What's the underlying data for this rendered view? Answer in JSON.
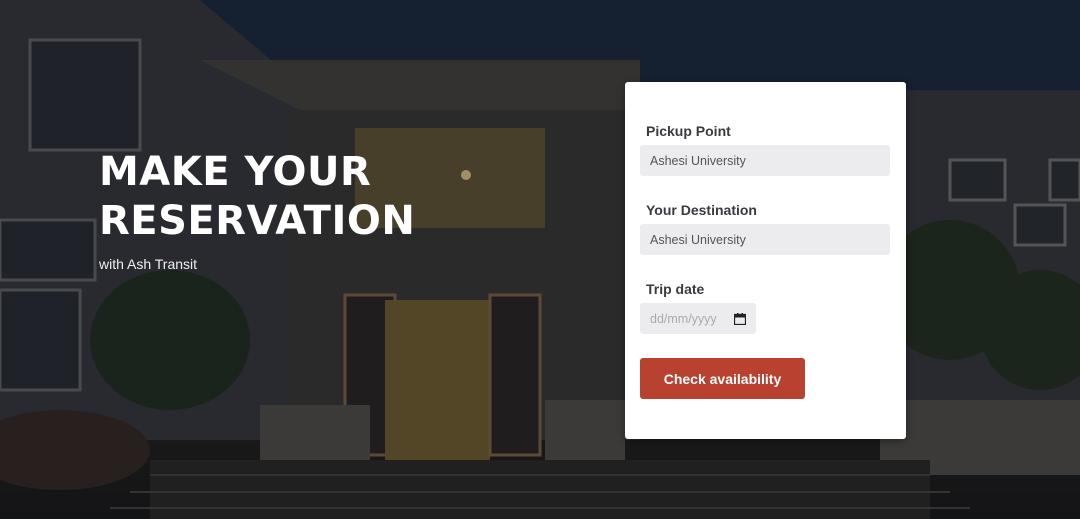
{
  "hero": {
    "title": "MAKE YOUR RESERVATION",
    "subtitle": "with Ash Transit"
  },
  "form": {
    "pickup": {
      "label": "Pickup Point",
      "value": "Ashesi University"
    },
    "destination": {
      "label": "Your Destination",
      "value": "Ashesi University"
    },
    "trip_date": {
      "label": "Trip date",
      "placeholder": "dd/mm/yyyy",
      "icon": "calendar-icon"
    },
    "submit_label": "Check availability"
  },
  "colors": {
    "accent": "#b84130",
    "card": "#ffffff",
    "input_bg": "#ececee"
  }
}
